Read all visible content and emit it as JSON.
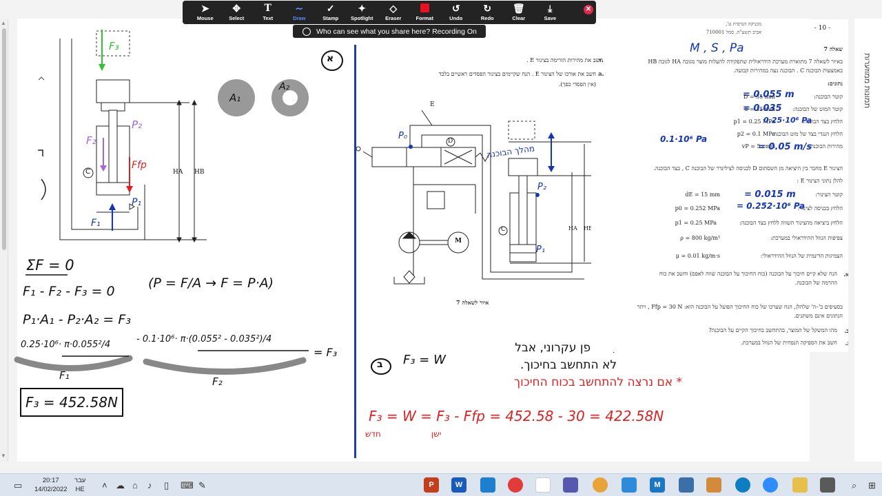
{
  "toolbar": {
    "tools": [
      {
        "label": "Mouse",
        "icon": "cursor-icon"
      },
      {
        "label": "Select",
        "icon": "move-icon"
      },
      {
        "label": "Text",
        "icon": "text-icon"
      },
      {
        "label": "Draw",
        "icon": "pen-icon"
      },
      {
        "label": "Stamp",
        "icon": "check-icon"
      },
      {
        "label": "Spotlight",
        "icon": "spotlight-icon"
      },
      {
        "label": "Eraser",
        "icon": "eraser-icon"
      },
      {
        "label": "Format",
        "icon": "color-square-icon"
      },
      {
        "label": "Undo",
        "icon": "undo-icon"
      },
      {
        "label": "Redo",
        "icon": "redo-icon"
      },
      {
        "label": "Clear",
        "icon": "trash-icon"
      },
      {
        "label": "Save",
        "icon": "download-icon"
      }
    ],
    "active_tool": "Draw",
    "share_notice": "Who can see what you share here? Recording On",
    "format_color": "#e81123"
  },
  "document": {
    "header_right": "מכניקה הנדסית ט',",
    "header_right2": "אביב תשע\"ה, סמל 710001",
    "page_number": "- 10 -",
    "question_title": "שאלה 7",
    "intro_line1": "באיור לשאלה 7 מתוארת מערכת הידראולית שתפקידה להעלות מוצר מגובה HA לגובה HB",
    "intro_line2": "באמצעות הבוכנה C . הבוכנה נעה במהירות קבועה.",
    "given_label": "נתונים:",
    "given": [
      {
        "label": "קוטר הבוכנה:",
        "value": "D = 55 mm"
      },
      {
        "label": "קוטר המוט של הבוכנה:",
        "value": "d = 35 mm"
      },
      {
        "label": "הלחץ בצד הבוכנה:",
        "value": "p1 = 0.25 MPa"
      },
      {
        "label": "הלחץ הנגדי בצד של מוט הבוכנה:",
        "value": "p2 = 0.1 MPa"
      },
      {
        "label": "מהירות הבוכנה:",
        "value": "vP = 5 cm/s"
      }
    ],
    "pipe_line": "הצינור E מחבר בין היציאה מן השסתום D לכניסה לצילינדר של הבוכנה C , בצד הבוכנה.",
    "pipe_data_label": "להלן נתוני הצינור E :",
    "pipe_given": [
      {
        "label": "קוטר הצינור:",
        "value": "dE = 15 mm"
      },
      {
        "label": "הלחץ בכניסה לצינור:",
        "value": "p0 = 0.252 MPa"
      },
      {
        "label": "הלחץ ביציאה מהצינור השווה ללחץ בצד הבוכנה:",
        "value": "p1 = 0.25 MPa"
      },
      {
        "label": "צפיפות הנוזל ההידראולי במערכת:",
        "value": "ρ = 800 kg/m³"
      },
      {
        "label": "הצמיגות הדינמית של הנוזל ההידראולי:",
        "value": "μ = 0.01 kg/m·s"
      }
    ],
    "q_a_letter": "א.",
    "q_a": "הנח שלא קיים חיכוך על הבוכנה (כוח החיכוך על הבוכנה שווה לאפס) וחשב את כוח",
    "q_a2": "ההרמה של הבוכנה.",
    "note_line1": "בסעיפים ב'–ה' שלהלן, הנח שערכו של כוח החיכוך הפועל על הבוכנה הוא: Ffp = 30 N , ויתר",
    "note_line2": "הנתונים אינם משתנים.",
    "q_b_letter": "ב.",
    "q_b": "מהו המשקל של המוצר, בהתחשב בחיכוך הקיים על הבוכנה?",
    "q_c_letter": "ג.",
    "q_c": "חשב את הספיקה הנפחית של הנוזל במערכת.",
    "q_d_letter": "ד.",
    "q_d": "חשב את מהירות הזרימה בצינור E .",
    "q_e_letter": "ה.",
    "q_e": "חשב את אורכו של הצינור E . הנח שקיימים בצינור הפסדים ראשיים בלבד",
    "q_e2": "(אין הפסדי כפך)."
  },
  "figure_caption": "איור לשאלה 7",
  "figure_labels": {
    "E": "E",
    "D": "D",
    "M": "M",
    "C": "C",
    "HA": "HA",
    "HB": "HB"
  },
  "handwriting": {
    "given_symbols": "M , S , Pa",
    "d_val": "= 0.055 m",
    "dd_val": "= 0.035",
    "p1_val": "0.25·10⁶ Pa",
    "p2_val": "0.1·10⁶ Pa",
    "vp_val": "= 0.05 m/s",
    "de_val": "= 0.015 m",
    "p0_val": "= 0.252·10⁶ Pa",
    "circle_a": "א",
    "circle_b": "ב",
    "sum_f": "ΣF = 0",
    "eq1": "F₁ - F₂ - F₃ = 0",
    "eq2": "P₁·A₁ - P₂·A₂ = F₃",
    "eq_p": "(P = F/A → F = P·A)",
    "eq3_left": "0.25·10⁶· π·0.055²/4",
    "eq3_mid": "- 0.1·10⁶· π·(0.055² - 0.035²)/4",
    "eq3_right": "= F₃",
    "f1_label": "F₁",
    "f2_label": "F₂",
    "answer": "F₃ = 452.58N",
    "f3_w": "F₃ = W",
    "f3_w_note": "( באופן עקרוני, אבל",
    "f3_w_note2": "לא התחשב בחיכוך.",
    "star_note": "* אם נרצה להתחשב בכוח החיכוך",
    "final": "F₃ = W = F₃ - Ffp = 452.58 - 30 = 422.58N",
    "new_label": "חדש",
    "old_label": "ישן",
    "pressure_line": "מהלך הבוכנה",
    "A1": "A₁",
    "A2": "A₂",
    "F3": "F₃",
    "F2": "F₂",
    "Ffp": "Ffp",
    "P2": "P₂",
    "P1": "P₁",
    "F1": "F₁",
    "P0": "P₀"
  },
  "right_panel": {
    "vertical_text": "תמונות ממוזערות"
  },
  "taskbar": {
    "time": "20:17",
    "date": "14/02/2022",
    "lang_top": "עבר",
    "lang_bottom": "HE",
    "apps": [
      "P",
      "W",
      "",
      "M",
      "",
      "",
      "",
      "",
      "",
      "",
      "",
      "",
      "",
      ""
    ]
  }
}
